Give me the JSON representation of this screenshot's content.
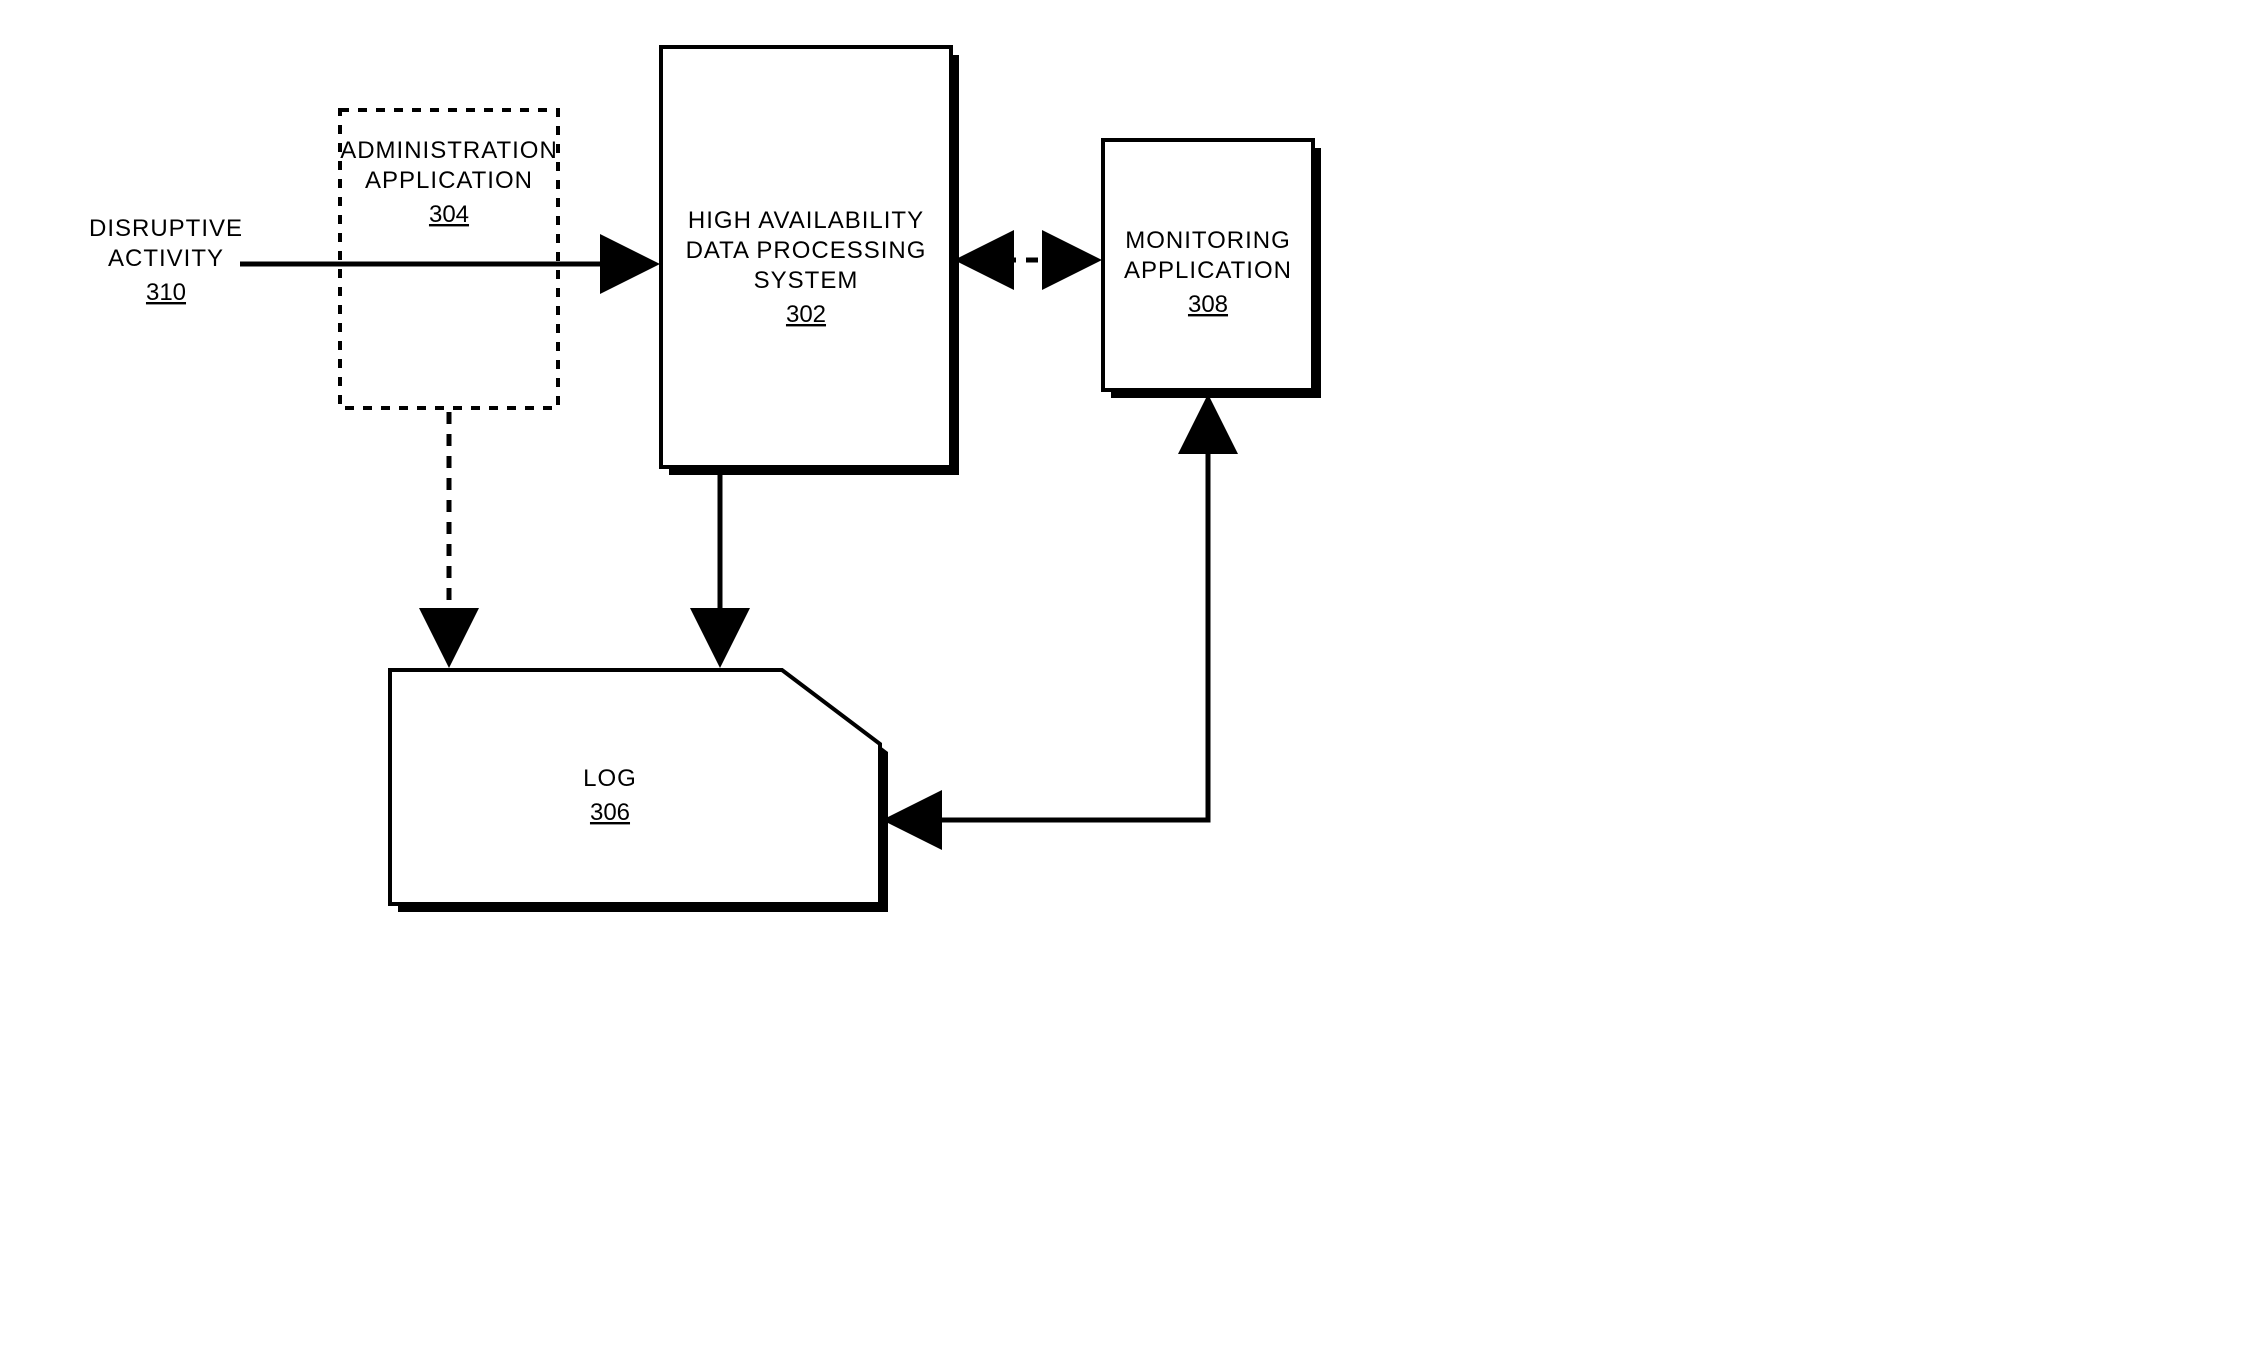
{
  "nodes": {
    "disruptive": {
      "line1": "DISRUPTIVE",
      "line2": "ACTIVITY",
      "ref": "310"
    },
    "admin": {
      "line1": "ADMINISTRATION",
      "line2": "APPLICATION",
      "ref": "304"
    },
    "hads": {
      "line1": "HIGH AVAILABILITY",
      "line2": "DATA PROCESSING",
      "line3": "SYSTEM",
      "ref": "302"
    },
    "monitor": {
      "line1": "MONITORING",
      "line2": "APPLICATION",
      "ref": "308"
    },
    "log": {
      "line1": "LOG",
      "ref": "306"
    }
  }
}
